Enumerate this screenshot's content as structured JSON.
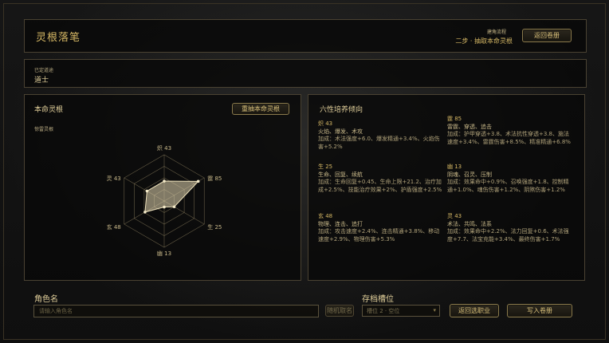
{
  "header": {
    "title": "灵根落笔",
    "flow_label": "建角流程",
    "flow_step": "二步 · 抽取本命灵根",
    "back_button": "返回卷册"
  },
  "daotong": {
    "label": "已定道途",
    "value": "道士"
  },
  "root": {
    "title": "本命灵根",
    "subtitle": "惊雷灵根",
    "redraw_button": "重抽本命灵根"
  },
  "chart_data": {
    "type": "radar",
    "axes": [
      "炽 43",
      "霆 85",
      "生 25",
      "幽 13",
      "玄 48",
      "灵 43"
    ],
    "values": [
      43,
      85,
      25,
      13,
      48,
      43
    ],
    "range": [
      0,
      100
    ],
    "rings": 4
  },
  "traits": {
    "title": "六性培养倾向",
    "items": [
      {
        "name": "炽 43",
        "tags": "火焰、爆发、术攻",
        "bonus": "加成：术法强度+6.0、爆发精通+3.4%、火焰伤害+5.2%"
      },
      {
        "name": "霆 85",
        "tags": "雷霆、穿透、追击",
        "bonus": "加成：护甲穿透+3.8、术法抗性穿透+3.8、施法速度+3.4%、雷霆伤害+8.5%、精准精通+6.8%"
      },
      {
        "name": "生 25",
        "tags": "生命、回复、续航",
        "bonus": "加成：生命回复+0.45、生命上限+21.2、治疗加成+2.5%、技能治疗效果+2%、护盾强度+2.5%"
      },
      {
        "name": "幽 13",
        "tags": "阴魂、召灵、压制",
        "bonus": "加成：效果命中+0.9%、召唤强度+1.8、控制精通+1.0%、魂伤伤害+1.2%、阴煞伤害+1.2%"
      },
      {
        "name": "玄 48",
        "tags": "物理、连击、追打",
        "bonus": "加成：攻击速度+2.4%、连击精通+3.8%、移动速度+2.9%、物理伤害+5.3%"
      },
      {
        "name": "灵 43",
        "tags": "术法、共鸣、法系",
        "bonus": "加成：效果命中+2.2%、法力回复+0.6、术法强度+7.7、法宝充能+3.4%、最终伤害+1.7%"
      }
    ]
  },
  "bottom": {
    "char_label": "角色名",
    "name_placeholder": "请输入角色名",
    "random_button": "随机取名",
    "slot_label": "存档槽位",
    "slot_value": "槽位 2 · 空位",
    "return_button": "返回选职业",
    "write_button": "写入卷册"
  },
  "colors": {
    "gold": "#d6b865",
    "text": "#b9ab82",
    "border": "#4a4232"
  }
}
